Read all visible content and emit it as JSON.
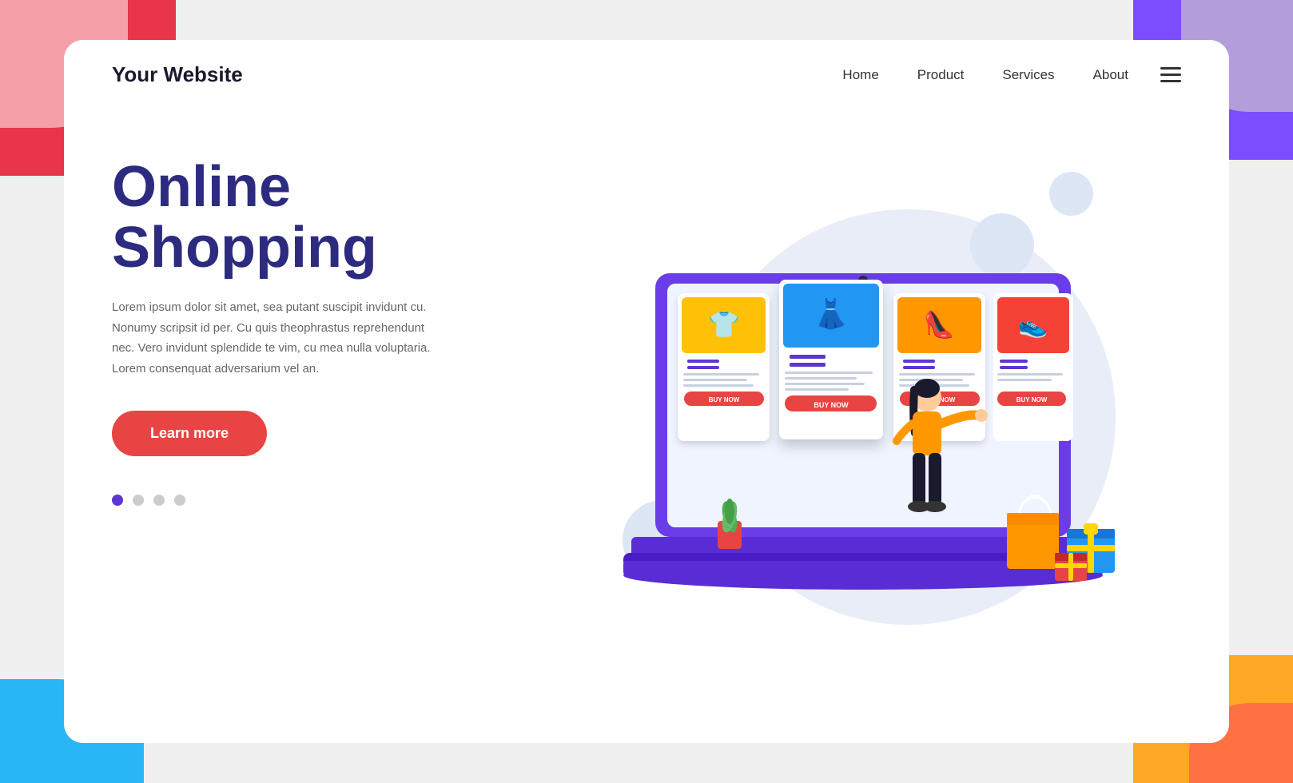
{
  "page": {
    "background_corners": {
      "tl_color": "#e8354a",
      "tl2_color": "#f5a0a8",
      "tr_color": "#7c4dff",
      "tr2_color": "#b39ddb",
      "bl_color": "#29b6f6",
      "br_color": "#ffa726",
      "br2_color": "#ff7043"
    }
  },
  "navbar": {
    "logo": "Your Website",
    "links": [
      {
        "label": "Home",
        "active": true
      },
      {
        "label": "Product",
        "active": false
      },
      {
        "label": "Services",
        "active": false
      },
      {
        "label": "About",
        "active": false
      }
    ]
  },
  "hero": {
    "title_line1": "Online",
    "title_line2": "Shopping",
    "description": "Lorem ipsum dolor sit amet, sea putant suscipit invidunt cu. Nonumy scripsit id per. Cu quis theophrastus reprehendunt nec. Vero invidunt splendide te vim, cu mea nulla voluptaria. Lorem consenquat adversarium vel an.",
    "cta_button": "Learn more",
    "dots": [
      {
        "active": true
      },
      {
        "active": false
      },
      {
        "active": false
      },
      {
        "active": false
      }
    ]
  },
  "product_cards": [
    {
      "icon": "👕",
      "bg_color": "#ffc107",
      "buy_label": "BUY NOW",
      "selected": false
    },
    {
      "icon": "👗",
      "bg_color": "#2196f3",
      "buy_label": "BUY NOW",
      "selected": true
    },
    {
      "icon": "👠",
      "bg_color": "#ff9800",
      "buy_label": "BUY NOW",
      "selected": false
    },
    {
      "icon": "👟",
      "bg_color": "#f44336",
      "buy_label": "BUY NOW",
      "selected": false
    }
  ]
}
